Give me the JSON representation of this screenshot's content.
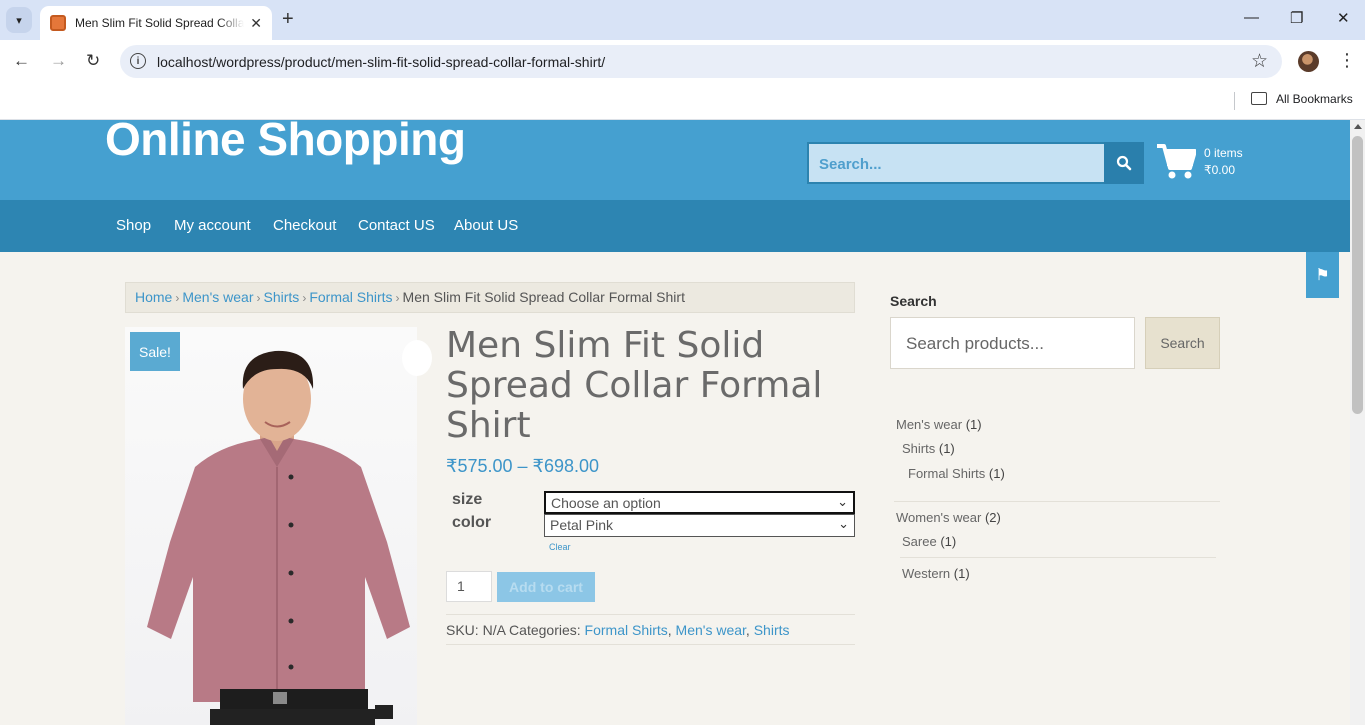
{
  "browser": {
    "tab_title": "Men Slim Fit Solid Spread Colla",
    "tab_close": "✕",
    "new_tab": "+",
    "url": "localhost/wordpress/product/men-slim-fit-solid-spread-collar-formal-shirt/",
    "bookmarks_label": "All Bookmarks",
    "icons": [
      "tab-search-icon",
      "favicon-icon",
      "close-icon",
      "plus-icon",
      "minimize-icon",
      "restore-icon",
      "close-window-icon",
      "back-icon",
      "forward-icon",
      "reload-icon",
      "info-icon",
      "star-icon",
      "avatar",
      "menu-icon",
      "folder-icon"
    ]
  },
  "header": {
    "site_title": "Online Shopping",
    "search_placeholder": "Search...",
    "cart_items": "0 items",
    "cart_total": "₹0.00",
    "bg_color": "#45a0d0"
  },
  "nav": {
    "items": [
      "Shop",
      "My account",
      "Checkout",
      "Contact US",
      "About US"
    ],
    "bg_color": "#2d85b2"
  },
  "breadcrumb": {
    "items": [
      "Home",
      "Men's wear",
      "Shirts",
      "Formal Shirts"
    ],
    "current": "Men Slim Fit Solid Spread Collar Formal Shirt"
  },
  "product": {
    "sale_badge": "Sale!",
    "title": "Men Slim Fit Solid Spread Collar Formal Shirt",
    "price": "₹575.00 – ₹698.00",
    "size_label": "size",
    "size_value": "Choose an option",
    "color_label": "color",
    "color_value": "Petal Pink",
    "clear_label": "Clear",
    "quantity": "1",
    "add_to_cart": "Add to cart",
    "sku_label": "SKU:",
    "sku_value": "N/A",
    "categories_label": "Categories:",
    "categories": [
      "Formal Shirts",
      "Men's wear",
      "Shirts"
    ]
  },
  "sidebar": {
    "search_heading": "Search",
    "search_placeholder": "Search products...",
    "search_button": "Search",
    "categories": [
      {
        "name": "Men's wear",
        "count": "(1)"
      },
      {
        "name": "Shirts",
        "count": "(1)"
      },
      {
        "name": "Formal Shirts",
        "count": "(1)"
      },
      {
        "name": "Women's wear",
        "count": "(2)"
      },
      {
        "name": "Saree",
        "count": "(1)"
      },
      {
        "name": "Western",
        "count": "(1)"
      }
    ]
  }
}
